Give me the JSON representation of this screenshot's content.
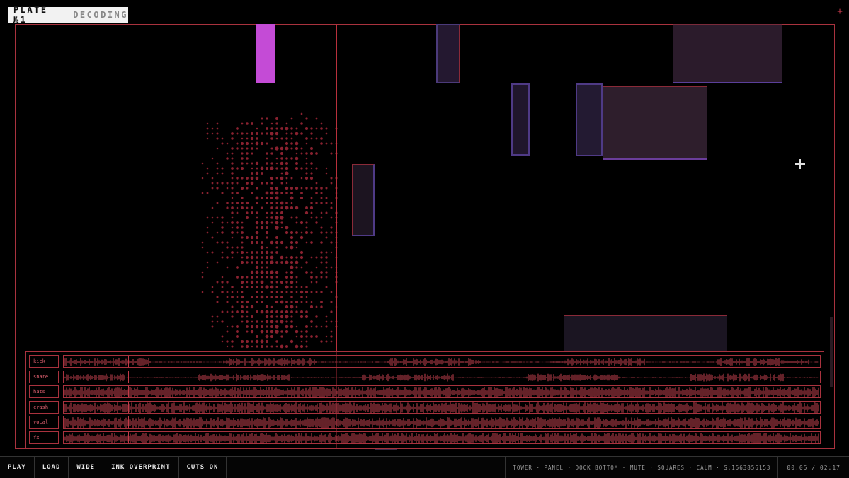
{
  "plate": {
    "title": "PLATE №1",
    "status": "DECODING"
  },
  "tracks": [
    {
      "label": "kick"
    },
    {
      "label": "snare"
    },
    {
      "label": "hats"
    },
    {
      "label": "crash"
    },
    {
      "label": "vocal"
    },
    {
      "label": "fx"
    }
  ],
  "toolbar": {
    "play": "PLAY",
    "load": "LOAD",
    "wide": "WIDE",
    "ink_overprint": "INK OVERPRINT",
    "cuts": "CUTS ON"
  },
  "status_line": "TOWER · PANEL · DOCK BOTTOM · MUTE · SQUARES · CALM · S:1563856153",
  "time": {
    "current": "00:05",
    "total": "02:17",
    "display": "00:05 / 02:17"
  },
  "colors": {
    "accent": "#a9323e",
    "magenta": "#c44bd6",
    "violet": "#5a3f86",
    "background": "#000000"
  },
  "icons": {
    "corner": "plus-icon",
    "cursor": "crosshair-icon"
  }
}
